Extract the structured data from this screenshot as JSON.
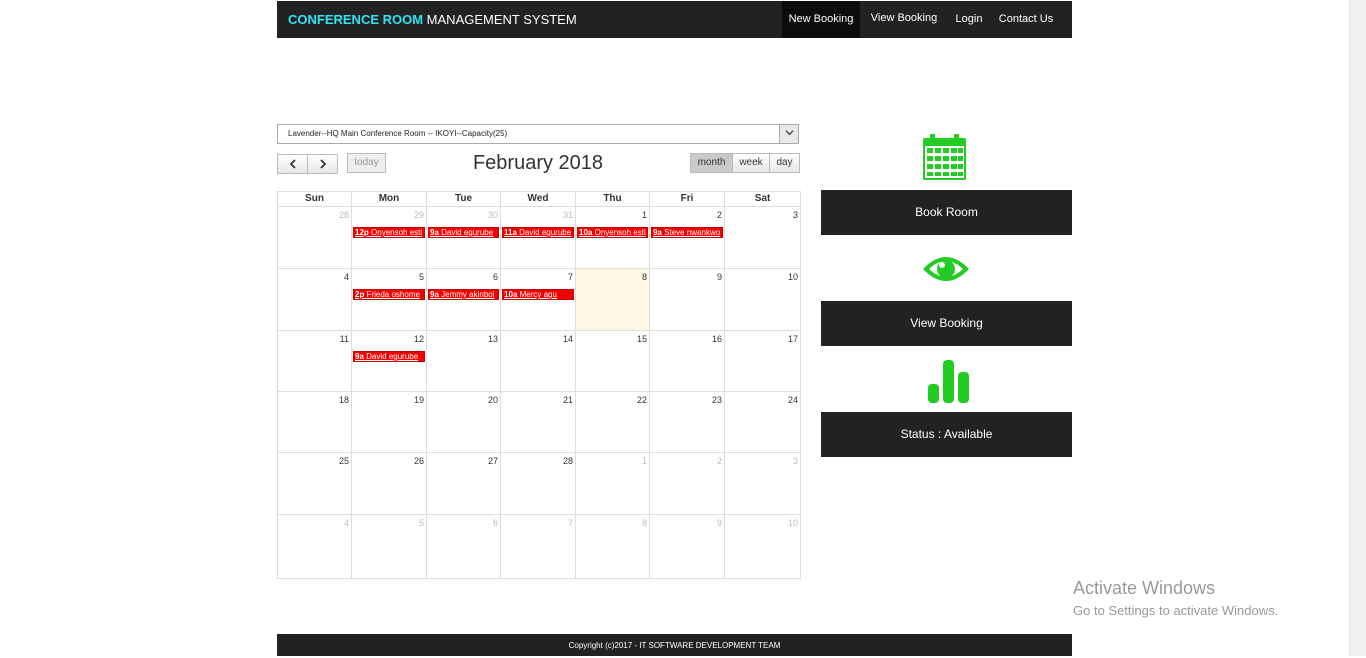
{
  "navbar": {
    "brand_highlight": "CONFERENCE ROOM",
    "brand_rest": " MANAGEMENT SYSTEM",
    "items": [
      "New Booking",
      "View Booking",
      "Login",
      "Contact Us"
    ]
  },
  "room_select": {
    "value": "Lavender--HQ Main Conference Room -- IKOYI--Capacity(25)"
  },
  "toolbar": {
    "prev": "‹",
    "next": "›",
    "today": "today",
    "title": "February 2018",
    "views": [
      "month",
      "week",
      "day"
    ],
    "active_view": "month"
  },
  "calendar": {
    "weekdays": [
      "Sun",
      "Mon",
      "Tue",
      "Wed",
      "Thu",
      "Fri",
      "Sat"
    ],
    "weeks": [
      [
        {
          "d": "28",
          "o": true
        },
        {
          "d": "29",
          "o": true
        },
        {
          "d": "30",
          "o": true
        },
        {
          "d": "31",
          "o": true
        },
        {
          "d": "1"
        },
        {
          "d": "2"
        },
        {
          "d": "3"
        }
      ],
      [
        {
          "d": "4"
        },
        {
          "d": "5"
        },
        {
          "d": "6"
        },
        {
          "d": "7"
        },
        {
          "d": "8",
          "today": true
        },
        {
          "d": "9"
        },
        {
          "d": "10"
        }
      ],
      [
        {
          "d": "11"
        },
        {
          "d": "12"
        },
        {
          "d": "13"
        },
        {
          "d": "14"
        },
        {
          "d": "15"
        },
        {
          "d": "16"
        },
        {
          "d": "17"
        }
      ],
      [
        {
          "d": "18"
        },
        {
          "d": "19"
        },
        {
          "d": "20"
        },
        {
          "d": "21"
        },
        {
          "d": "22"
        },
        {
          "d": "23"
        },
        {
          "d": "24"
        }
      ],
      [
        {
          "d": "25"
        },
        {
          "d": "26"
        },
        {
          "d": "27"
        },
        {
          "d": "28"
        },
        {
          "d": "1",
          "o": true
        },
        {
          "d": "2",
          "o": true
        },
        {
          "d": "3",
          "o": true
        }
      ],
      [
        {
          "d": "4",
          "o": true
        },
        {
          "d": "5",
          "o": true
        },
        {
          "d": "6",
          "o": true
        },
        {
          "d": "7",
          "o": true
        },
        {
          "d": "8",
          "o": true
        },
        {
          "d": "9",
          "o": true
        },
        {
          "d": "10",
          "o": true
        }
      ]
    ],
    "events": [
      {
        "week": 0,
        "day": 1,
        "time": "12p",
        "title": "Onyensoh esti"
      },
      {
        "week": 0,
        "day": 2,
        "time": "9a",
        "title": "David egurube"
      },
      {
        "week": 0,
        "day": 3,
        "time": "11a",
        "title": "David egurube"
      },
      {
        "week": 0,
        "day": 4,
        "time": "10a",
        "title": "Onyensoh esti"
      },
      {
        "week": 0,
        "day": 5,
        "time": "9a",
        "title": "Steve nwankwo"
      },
      {
        "week": 1,
        "day": 1,
        "time": "2p",
        "title": "Frieda oshome"
      },
      {
        "week": 1,
        "day": 2,
        "time": "9a",
        "title": "Jemmy akinboi"
      },
      {
        "week": 1,
        "day": 3,
        "time": "10a",
        "title": "Mercy agu"
      },
      {
        "week": 2,
        "day": 1,
        "time": "9a",
        "title": "David egurube"
      }
    ],
    "event_color": "#f20000",
    "today_color": "#fcf8e3"
  },
  "side_panel": {
    "accent_color": "#22cc22",
    "book_room": "Book Room",
    "view_booking": "View Booking",
    "status": "Status : Available",
    "icons": [
      "calendar-icon",
      "eye-icon",
      "bar-chart-icon"
    ]
  },
  "watermark": {
    "line1": "Activate Windows",
    "line2": "Go to Settings to activate Windows."
  },
  "footer": {
    "text": "Copyright (c)2017 - IT SOFTWARE DEVELOPMENT TEAM"
  }
}
